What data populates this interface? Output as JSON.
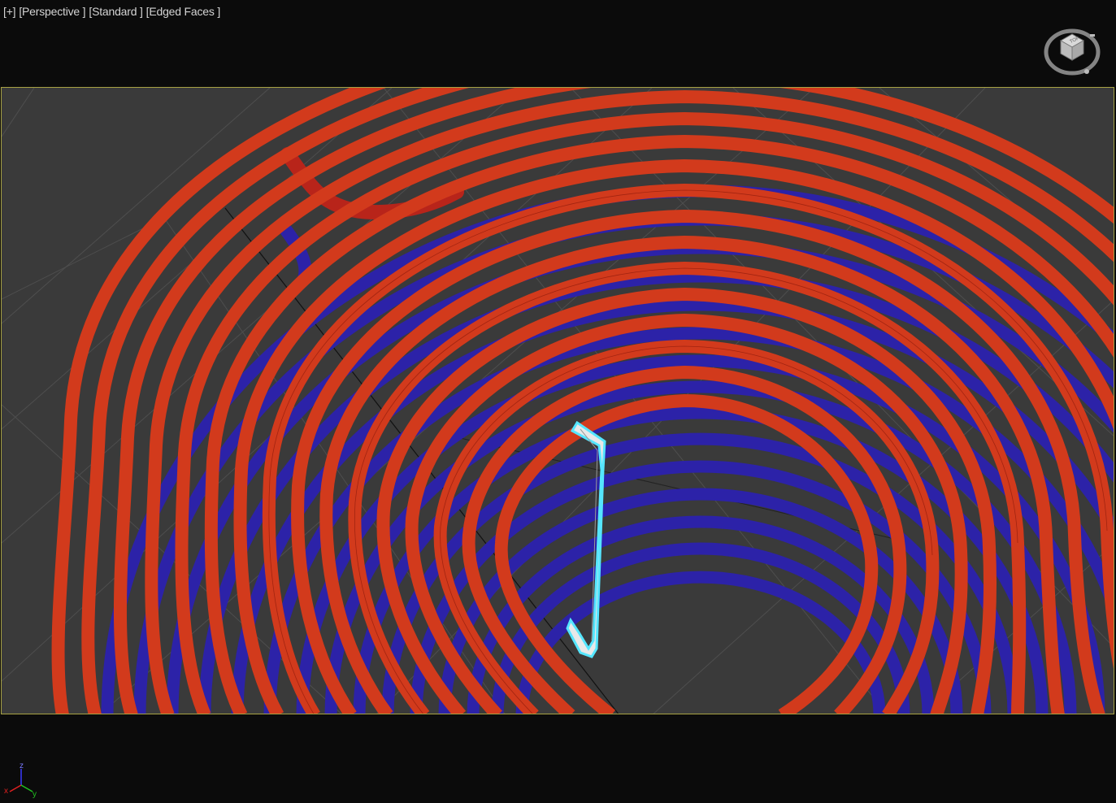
{
  "viewport": {
    "menu_label": "[+]",
    "view_label": "[Perspective ]",
    "shading_label": "[Standard ]",
    "display_label": "[Edged Faces ]"
  },
  "viewcube": {
    "icon": "viewcube-icon",
    "face_text": "TOP"
  },
  "axis_tripod": {
    "x_label": "x",
    "y_label": "y",
    "z_label": "z"
  },
  "colors": {
    "background": "#0b0b0b",
    "grid_floor": "#3a3a3a",
    "safe_frame_border": "#a7a244",
    "pipe_red": "#d23a1c",
    "pipe_blue": "#2c22a8",
    "selection": "#55e6ff"
  }
}
